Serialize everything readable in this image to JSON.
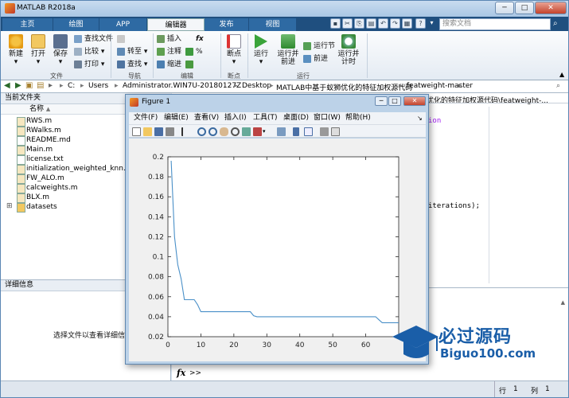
{
  "window": {
    "title": "MATLAB R2018a"
  },
  "tabs": [
    "主页",
    "绘图",
    "APP",
    "编辑器",
    "发布",
    "视图"
  ],
  "active_tab": "编辑器",
  "search": {
    "placeholder": "搜索文档"
  },
  "ribbon": {
    "file": {
      "new": "新建",
      "open": "打开",
      "save": "保存",
      "find_files": "查找文件",
      "compare": "比较",
      "print": "打印",
      "group": "文件"
    },
    "nav": {
      "goto": "转至",
      "find": "查找",
      "group": "导航"
    },
    "edit": {
      "insert": "插入",
      "comment": "注释",
      "indent": "缩进",
      "fx": "fx",
      "group": "编辑"
    },
    "breakpoints": {
      "label": "断点",
      "group": "断点"
    },
    "run": {
      "run": "运行",
      "run_advance": "运行并\n前进",
      "run_section": "运行节",
      "advance": "前进",
      "run_time": "运行并\n计时",
      "group": "运行"
    }
  },
  "address": [
    "C:",
    "Users",
    "Administrator.WIN7U-20180127Z",
    "Desktop",
    "MATLAB中基于蚁狮优化的特征加权源代码",
    "featweight-master"
  ],
  "current_folder": {
    "title": "当前文件夹",
    "col_name": "名称",
    "sort_arrow": "▲"
  },
  "files": [
    {
      "name": "RWS.m",
      "type": "m"
    },
    {
      "name": "RWalks.m",
      "type": "m"
    },
    {
      "name": "README.md",
      "type": "md"
    },
    {
      "name": "Main.m",
      "type": "m"
    },
    {
      "name": "license.txt",
      "type": "txt"
    },
    {
      "name": "initialization_weighted_knn.m",
      "type": "m"
    },
    {
      "name": "FW_ALO.m",
      "type": "m"
    },
    {
      "name": "calcweights.m",
      "type": "m"
    },
    {
      "name": "BLX.m",
      "type": "m"
    },
    {
      "name": "datasets",
      "type": "folder"
    }
  ],
  "details": {
    "title": "详细信息",
    "hint": "选择文件以查看详细信息"
  },
  "editor": {
    "path_fragment": "优化的特征加权源代码\\featweight-...",
    "code_fragment_1": "ion",
    "code_fragment_2": "iterations);"
  },
  "command": {
    "prompt": "fx",
    "chevrons": ">>"
  },
  "statusbar": {
    "row_label": "行",
    "row": "1",
    "col_label": "列",
    "col": "1"
  },
  "figure": {
    "title": "Figure 1",
    "menus": [
      "文件(F)",
      "编辑(E)",
      "查看(V)",
      "插入(I)",
      "工具(T)",
      "桌面(D)",
      "窗口(W)",
      "帮助(H)"
    ]
  },
  "chart_data": {
    "type": "line",
    "title": "",
    "xlabel": "",
    "ylabel": "",
    "xlim": [
      0,
      70
    ],
    "ylim": [
      0.02,
      0.2
    ],
    "xticks": [
      0,
      10,
      20,
      30,
      40,
      50,
      60
    ],
    "yticks": [
      0.02,
      0.04,
      0.06,
      0.08,
      0.1,
      0.12,
      0.14,
      0.16,
      0.18,
      0.2
    ],
    "grid": false,
    "color": "#4a90c8",
    "x": [
      1,
      2,
      3,
      4,
      5,
      6,
      7,
      8,
      9,
      10,
      11,
      12,
      13,
      14,
      15,
      16,
      17,
      18,
      19,
      20,
      21,
      22,
      23,
      24,
      25,
      26,
      27,
      28,
      29,
      30,
      31,
      32,
      33,
      34,
      35,
      36,
      37,
      38,
      39,
      40,
      41,
      42,
      43,
      44,
      45,
      46,
      47,
      48,
      49,
      50,
      51,
      52,
      53,
      54,
      55,
      56,
      57,
      58,
      59,
      60,
      61,
      62,
      63,
      64,
      65,
      66,
      67,
      68,
      69,
      70
    ],
    "y": [
      0.196,
      0.12,
      0.092,
      0.078,
      0.057,
      0.057,
      0.057,
      0.057,
      0.052,
      0.045,
      0.045,
      0.045,
      0.045,
      0.045,
      0.045,
      0.045,
      0.045,
      0.045,
      0.045,
      0.045,
      0.045,
      0.045,
      0.045,
      0.045,
      0.045,
      0.041,
      0.04,
      0.04,
      0.04,
      0.04,
      0.04,
      0.04,
      0.04,
      0.04,
      0.04,
      0.04,
      0.04,
      0.04,
      0.04,
      0.04,
      0.04,
      0.04,
      0.04,
      0.04,
      0.04,
      0.04,
      0.04,
      0.04,
      0.04,
      0.04,
      0.04,
      0.04,
      0.04,
      0.04,
      0.04,
      0.04,
      0.04,
      0.04,
      0.04,
      0.04,
      0.04,
      0.04,
      0.04,
      0.037,
      0.034,
      0.034,
      0.034,
      0.034,
      0.034,
      0.034
    ]
  },
  "watermark": {
    "text": "必过源码",
    "sub": "Biguo100.com"
  }
}
